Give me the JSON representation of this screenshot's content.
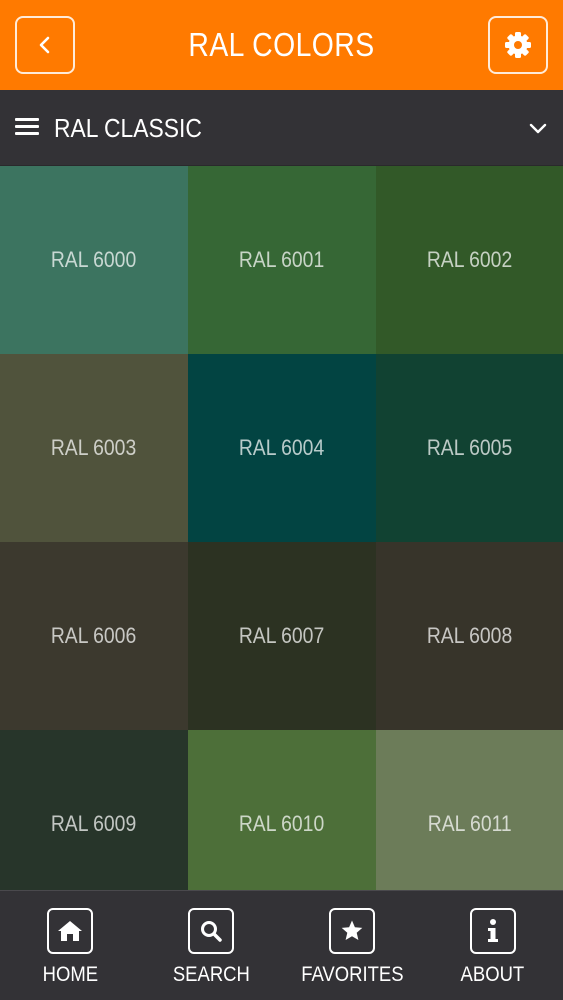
{
  "header": {
    "title": "RAL COLORS",
    "back_icon": "chevron-left-icon",
    "settings_icon": "gear-icon",
    "color": "#ff7a00"
  },
  "selector": {
    "label": "RAL CLASSIC",
    "menu_icon": "hamburger-icon",
    "dropdown_icon": "chevron-down-icon"
  },
  "swatches": [
    {
      "label": "RAL 6000",
      "color": "#3c7460"
    },
    {
      "label": "RAL 6001",
      "color": "#366735"
    },
    {
      "label": "RAL 6002",
      "color": "#325928"
    },
    {
      "label": "RAL 6003",
      "color": "#50533c"
    },
    {
      "label": "RAL 6004",
      "color": "#024442"
    },
    {
      "label": "RAL 6005",
      "color": "#114232"
    },
    {
      "label": "RAL 6006",
      "color": "#3c392e"
    },
    {
      "label": "RAL 6007",
      "color": "#2c3222"
    },
    {
      "label": "RAL 6008",
      "color": "#37342a"
    },
    {
      "label": "RAL 6009",
      "color": "#27352a"
    },
    {
      "label": "RAL 6010",
      "color": "#4d6f39"
    },
    {
      "label": "RAL 6011",
      "color": "#6c7c59"
    }
  ],
  "nav": [
    {
      "label": "HOME",
      "icon": "home-icon"
    },
    {
      "label": "SEARCH",
      "icon": "search-icon"
    },
    {
      "label": "FAVORITES",
      "icon": "star-icon"
    },
    {
      "label": "ABOUT",
      "icon": "info-icon"
    }
  ]
}
